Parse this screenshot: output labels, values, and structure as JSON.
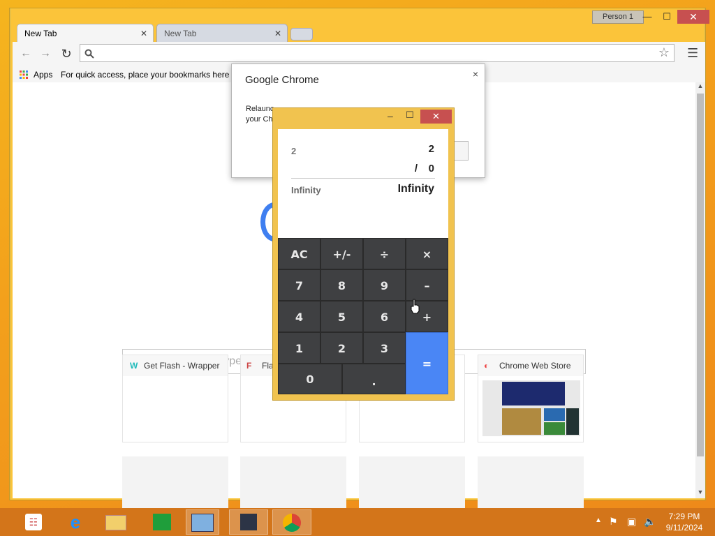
{
  "browser": {
    "profile": "Person 1",
    "tabs": [
      {
        "label": "New Tab",
        "active": true
      },
      {
        "label": "New Tab",
        "active": false
      }
    ],
    "bookmarks": {
      "apps_label": "Apps",
      "hint": "For quick access, place your bookmarks here o"
    },
    "newtab": {
      "search_placeholder": "Search Google or type URL",
      "tiles": [
        {
          "label": "Get Flash - Wrapper"
        },
        {
          "label": "Fla"
        },
        {
          "label": ""
        },
        {
          "label": "Chrome Web Store"
        }
      ]
    }
  },
  "dialog": {
    "title": "Google Chrome",
    "body_line1": "Relaunc",
    "body_line2": "your Ch",
    "close": "×"
  },
  "calculator": {
    "history_left": "2",
    "operand1": "2",
    "operator": "/",
    "operand2": "0",
    "result_left": "Infinity",
    "result_right": "Infinity",
    "keys": {
      "ac": "AC",
      "sign": "+/-",
      "divide": "÷",
      "multiply": "×",
      "seven": "7",
      "eight": "8",
      "nine": "9",
      "minus": "–",
      "four": "4",
      "five": "5",
      "six": "6",
      "plus": "+",
      "one": "1",
      "two": "2",
      "three": "3",
      "equals": "=",
      "zero": "0",
      "dot": "."
    },
    "accent": "#4a86f5"
  },
  "taskbar": {
    "time": "7:29 PM",
    "date": "9/11/2024"
  }
}
